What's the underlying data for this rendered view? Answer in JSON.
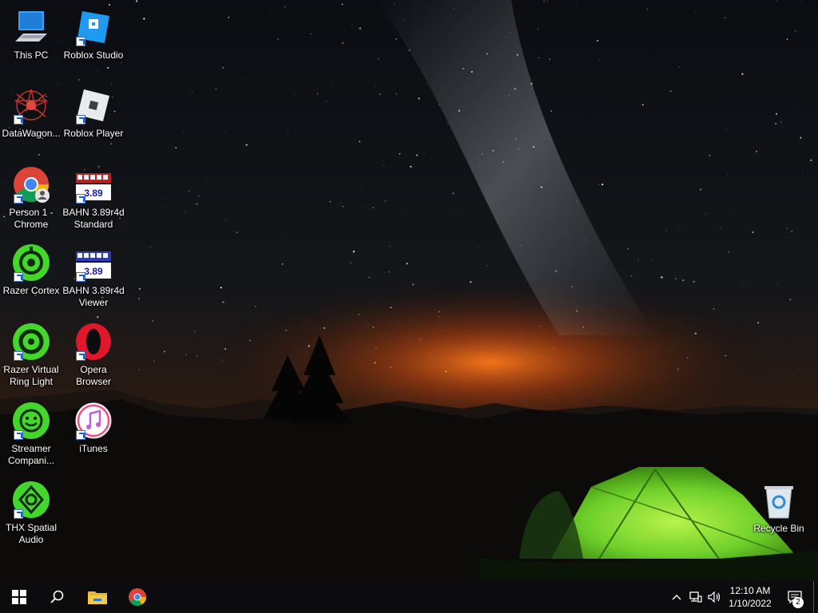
{
  "desktop": {
    "icons": [
      {
        "label": "This PC",
        "icon": "computer-icon"
      },
      {
        "label": "Roblox Studio",
        "icon": "roblox-studio-icon"
      },
      {
        "label": "DataWagon...",
        "icon": "datawagon-icon"
      },
      {
        "label": "Roblox Player",
        "icon": "roblox-player-icon"
      },
      {
        "label": "Person 1 -\nChrome",
        "icon": "chrome-icon"
      },
      {
        "label": "BAHN 3.89r4d\nStandard",
        "icon": "bahn-icon"
      },
      {
        "label": "Razer Cortex",
        "icon": "razer-cortex-icon"
      },
      {
        "label": "BAHN 3.89r4d\nViewer",
        "icon": "bahn-icon"
      },
      {
        "label": "Razer Virtual\nRing Light",
        "icon": "razer-ring-light-icon"
      },
      {
        "label": "Opera\nBrowser",
        "icon": "opera-icon"
      },
      {
        "label": "Streamer\nCompani...",
        "icon": "streamer-companion-icon"
      },
      {
        "label": "iTunes",
        "icon": "itunes-icon"
      },
      {
        "label": "THX Spatial\nAudio",
        "icon": "thx-icon"
      },
      {
        "label": "Recycle Bin",
        "icon": "recycle-bin-icon"
      }
    ],
    "bahn_version": "3.89"
  },
  "taskbar": {
    "apps": [
      "start-icon",
      "search-icon",
      "file-explorer-icon",
      "chrome-icon"
    ],
    "tray": {
      "time": "12:10 AM",
      "date": "1/10/2022",
      "notification_count": "2"
    }
  },
  "colors": {
    "taskbar": "#0c0c0e",
    "razer_green": "#44d62c",
    "tent_green": "#7fe03a",
    "sky_glow": "#ff7a1a"
  }
}
